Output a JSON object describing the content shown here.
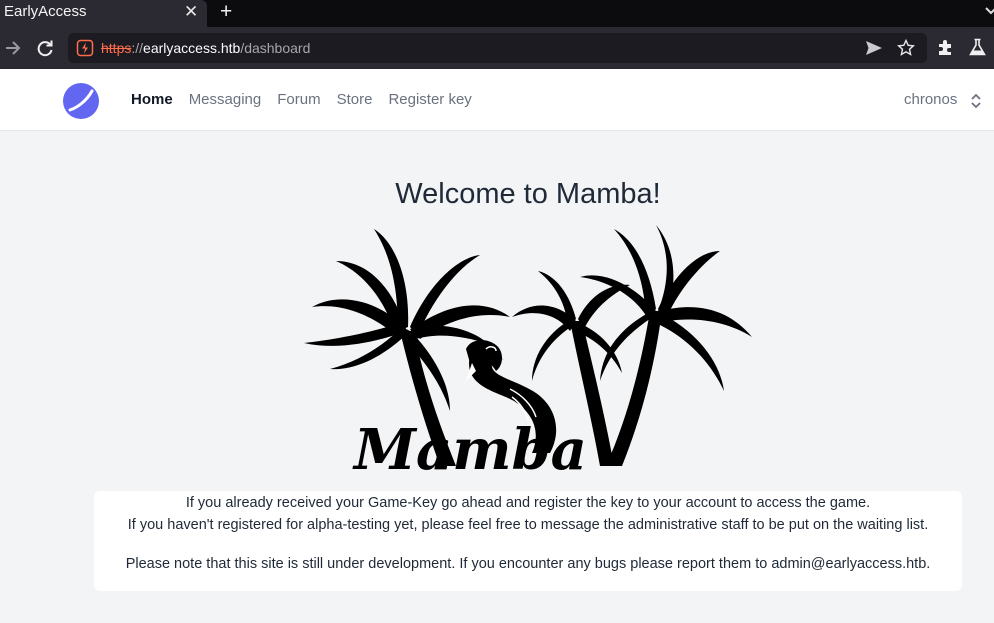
{
  "browser": {
    "tab_title": "EarlyAccess",
    "tab_close": "✕",
    "new_tab": "+",
    "url_scheme": "https",
    "url_sep": "://",
    "url_host": "earlyaccess.htb",
    "url_path": "/dashboard"
  },
  "site": {
    "nav_links": [
      "Home",
      "Messaging",
      "Forum",
      "Store",
      "Register key"
    ],
    "active_link": "Home",
    "username": "chronos",
    "brand_color": "#6366f1"
  },
  "main": {
    "welcome_title": "Welcome to Mamba!",
    "hero_logo_text": "Mamba",
    "info_line_1": "If you already received your Game-Key go ahead and register the key to your account to access the game.",
    "info_line_2": "If you haven't registered for alpha-testing yet, please feel free to message the administrative staff to be put on the waiting list.",
    "info_line_3": "Please note that this site is still under development. If you encounter any bugs please report them to admin@earlyaccess.htb."
  }
}
